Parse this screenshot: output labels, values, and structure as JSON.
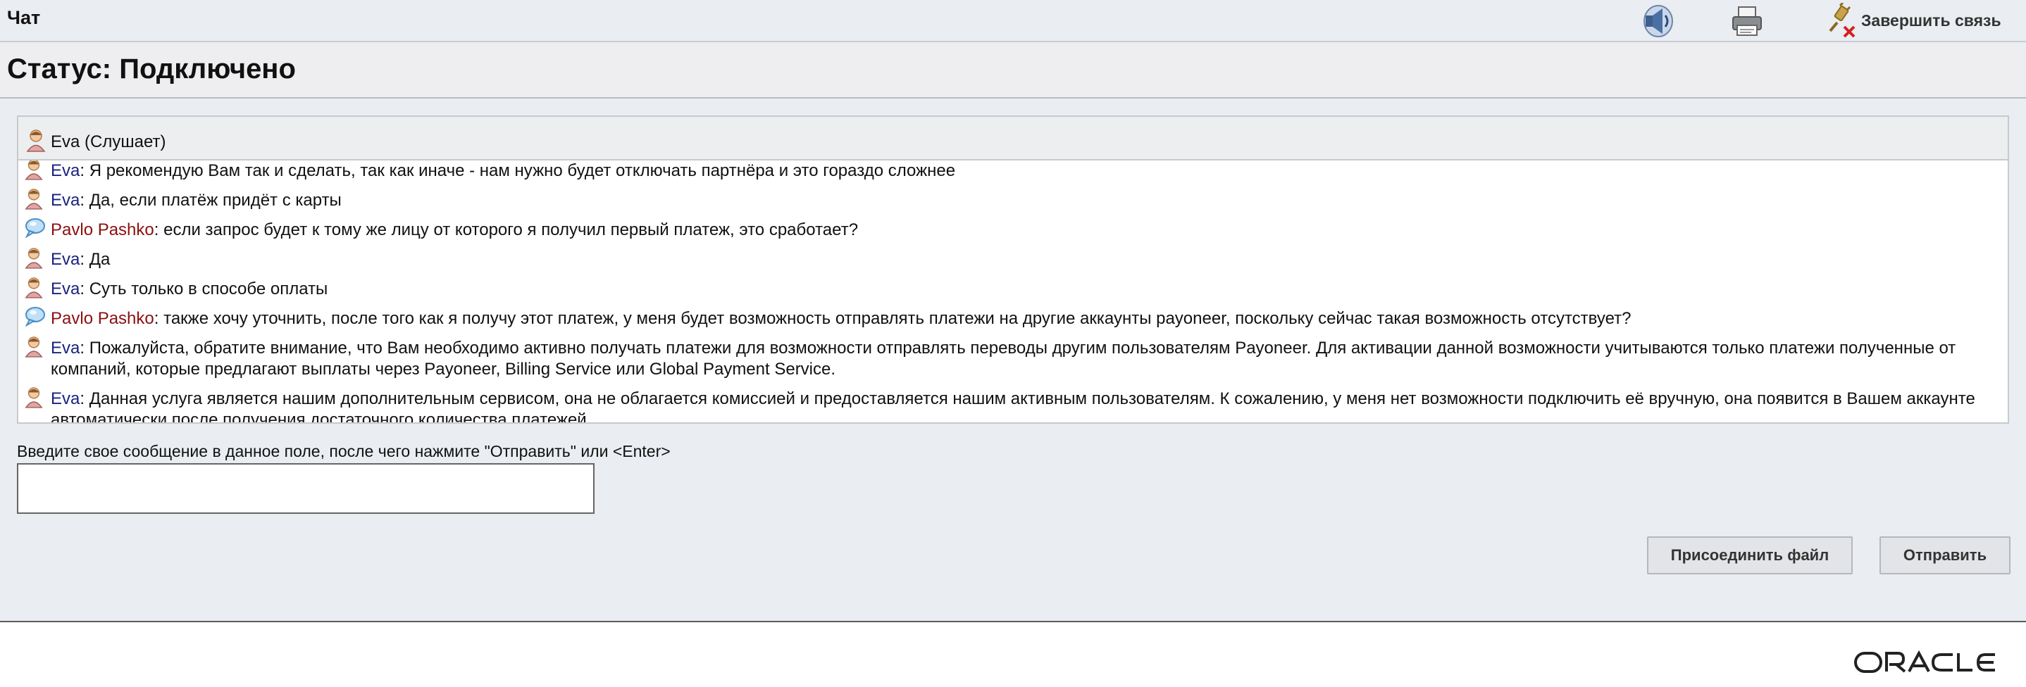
{
  "app": {
    "title": "Чат",
    "end_chat_label": "Завершить связь"
  },
  "toolbar": {
    "sound_icon": "speaker-icon",
    "print_icon": "printer-icon",
    "end_icon": "disconnect-plug-icon"
  },
  "status": "Статус: Подключено",
  "chat": {
    "header": "Eva (Слушает)",
    "messages": [
      {
        "sender": "Eva",
        "role": "agent",
        "text": ": Я рекомендую Вам так и сделать, так как иначе - нам нужно будет отключать партнёра и это гораздо сложнее"
      },
      {
        "sender": "Eva",
        "role": "agent",
        "text": ": Да, если платёж придёт с карты"
      },
      {
        "sender": "Pavlo Pashko",
        "role": "user",
        "text": ": если запрос будет к тому же лицу от которого я получил первый платеж, это сработает?"
      },
      {
        "sender": "Eva",
        "role": "agent",
        "text": ": Да"
      },
      {
        "sender": "Eva",
        "role": "agent",
        "text": ": Суть только в способе оплаты"
      },
      {
        "sender": "Pavlo Pashko",
        "role": "user",
        "text": ": также хочу уточнить, после того как я получу этот платеж, у меня будет возможность отправлять платежи на другие аккаунты payoneer, поскольку сейчас такая возможность отсутствует?"
      },
      {
        "sender": "Eva",
        "role": "agent",
        "text": ": Пожалуйста, обратите внимание, что Вам необходимо активно получать платежи для возможности отправлять переводы другим пользователям Payoneer. Для активации данной возможности учитываются только платежи полученные от компаний, которые предлагают выплаты через Payoneer, Billing Service или Global Payment Service."
      },
      {
        "sender": "Eva",
        "role": "agent",
        "text": ": Данная услуга является нашим дополнительным сервисом, она не облагается комиссией и предоставляется нашим активным пользователям. К сожалению, у меня нет возможности подключить её вручную, она появится в Вашем аккаунте автоматически после получения достаточного количества платежей."
      }
    ]
  },
  "input": {
    "prompt": "Введите свое сообщение в данное поле, после чего нажмите \"Отправить\" или <Enter>",
    "value": ""
  },
  "buttons": {
    "attach": "Присоединить файл",
    "send": "Отправить"
  },
  "footer": {
    "logo": "ORACLE"
  },
  "colors": {
    "agent_name": "#1a237e",
    "user_name": "#8b1010",
    "background": "#eaedf1"
  }
}
